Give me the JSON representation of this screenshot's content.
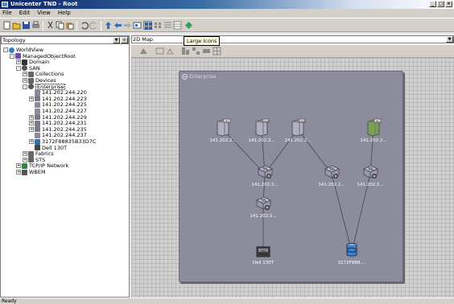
{
  "window": {
    "title": "Unicenter TND - Root",
    "controls": [
      "_",
      "□",
      "×"
    ]
  },
  "menu": [
    "File",
    "Edit",
    "View",
    "Help"
  ],
  "toolbar": {
    "tooltip": "Large Icons"
  },
  "left": {
    "dropdown_value": "Topology",
    "tree": [
      {
        "label": "WorldView",
        "level": 0,
        "toggle": "-",
        "icon": "globe-icon"
      },
      {
        "label": "ManagedObjectRoot",
        "level": 1,
        "toggle": "-",
        "icon": "root-object-icon"
      },
      {
        "label": "Domain",
        "level": 2,
        "toggle": "+",
        "icon": "domain-icon"
      },
      {
        "label": "SAN",
        "level": 2,
        "toggle": "-",
        "icon": "san-icon"
      },
      {
        "label": "Collections",
        "level": 3,
        "toggle": "+",
        "icon": "collections-icon"
      },
      {
        "label": "Devices",
        "level": 3,
        "toggle": "+",
        "icon": "devices-icon"
      },
      {
        "label": "Enterprise",
        "level": 3,
        "toggle": "-",
        "icon": "enterprise-icon",
        "selected": true
      },
      {
        "label": "141.202.244.220",
        "level": 4,
        "toggle": "",
        "icon": "switch-icon"
      },
      {
        "label": "141.202.244.223",
        "level": 4,
        "toggle": "+",
        "icon": "server-icon"
      },
      {
        "label": "141.202.244.225",
        "level": 4,
        "toggle": "",
        "icon": "switch-icon"
      },
      {
        "label": "141.202.244.227",
        "level": 4,
        "toggle": "",
        "icon": "switch-icon"
      },
      {
        "label": "141.202.244.229",
        "level": 4,
        "toggle": "+",
        "icon": "server-icon"
      },
      {
        "label": "141.202.244.231",
        "level": 4,
        "toggle": "+",
        "icon": "server-icon"
      },
      {
        "label": "141.202.244.235",
        "level": 4,
        "toggle": "+",
        "icon": "server-icon"
      },
      {
        "label": "141.202.244.237",
        "level": 4,
        "toggle": "",
        "icon": "switch-icon"
      },
      {
        "label": "3172F88835B33D7C",
        "level": 4,
        "toggle": "+",
        "icon": "storage-icon"
      },
      {
        "label": "Dell 130T",
        "level": 4,
        "toggle": "",
        "icon": "tape-library-icon"
      },
      {
        "label": "Fabrics",
        "level": 3,
        "toggle": "+",
        "icon": "fabrics-icon"
      },
      {
        "label": "STS",
        "level": 3,
        "toggle": "+",
        "icon": "sts-icon"
      },
      {
        "label": "TCP/IP Network",
        "level": 2,
        "toggle": "+",
        "icon": "network-icon"
      },
      {
        "label": "WBEM",
        "level": 2,
        "toggle": "+",
        "icon": "wbem-icon"
      }
    ]
  },
  "right": {
    "dropdown_value": "2D Map",
    "container_title": "Enterprise",
    "devices": [
      {
        "id": "d1",
        "label": "141.202.2...",
        "kind": "server-nt"
      },
      {
        "id": "d2",
        "label": "141.202.2...",
        "kind": "server-2000"
      },
      {
        "id": "d3",
        "label": "141.202.2...",
        "kind": "server-2000"
      },
      {
        "id": "d4",
        "label": "141.202.2...",
        "kind": "server-nt-green"
      },
      {
        "id": "d5",
        "label": "141.202.2...",
        "kind": "switch"
      },
      {
        "id": "d6",
        "label": "141.202.2...",
        "kind": "switch"
      },
      {
        "id": "d7",
        "label": "141.202.2...",
        "kind": "switch"
      },
      {
        "id": "d8",
        "label": "141.202.2...",
        "kind": "switch"
      },
      {
        "id": "d9",
        "label": "Dell 130T",
        "kind": "tape"
      },
      {
        "id": "d10",
        "label": "3172F888....",
        "kind": "storage"
      }
    ]
  },
  "status": "Ready",
  "colors": {
    "selection_blue": "#0a246a",
    "container": "#8c8c9c",
    "canvas": "#d0d0d0"
  }
}
